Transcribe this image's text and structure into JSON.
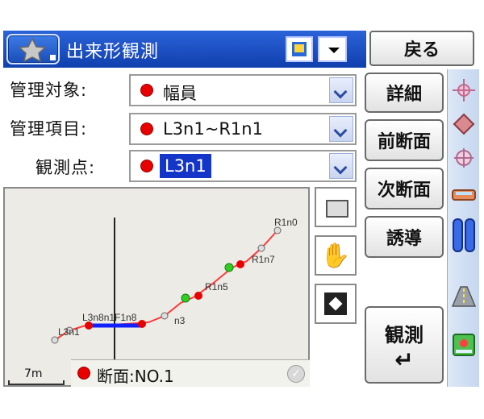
{
  "titlebar": {
    "app_title": "出来形観測",
    "back_label": "戻る"
  },
  "form": {
    "target_label": "管理対象:",
    "target_value": "幅員",
    "item_label": "管理項目:",
    "item_value": "L3n1~R1n1",
    "point_label": "観測点:",
    "point_value": "L3n1"
  },
  "side_buttons": {
    "detail": "詳細",
    "prev_section": "前断面",
    "next_section": "次断面",
    "guide": "誘導",
    "measure": "観測",
    "enter_glyph": "↵"
  },
  "map": {
    "section_label": "断面:NO.1",
    "scale_label": "7m",
    "hand_glyph": "✋",
    "ok_glyph": "✓",
    "point_labels": {
      "r1n0": "R1n0",
      "r1n7": "R1n7",
      "r1n5": "R1n5",
      "n3": "n3",
      "top_cluster": "L3n8n1F1n8",
      "l3n1": "L3n1"
    }
  },
  "colors": {
    "titlebar": "#1a4cc0",
    "selection": "#1436c8",
    "marker_red": "#e80000",
    "marker_green": "#33cc22",
    "line_red": "#ff3b3b",
    "line_blue": "#1020ff"
  }
}
